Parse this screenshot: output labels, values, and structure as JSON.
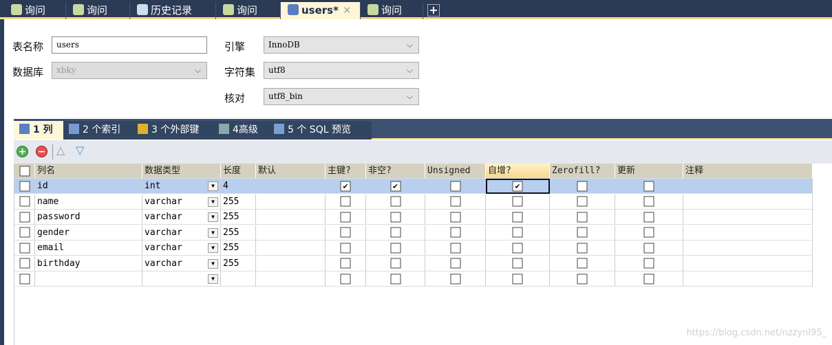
{
  "tabs": [
    {
      "label": "询问",
      "icon": "query-icon"
    },
    {
      "label": "询问",
      "icon": "query-icon"
    },
    {
      "label": "历史记录",
      "icon": "calendar-icon"
    },
    {
      "label": "询问",
      "icon": "query-icon"
    },
    {
      "label": "users*",
      "icon": "table-design-icon",
      "active": true,
      "close": "✕"
    },
    {
      "label": "询问",
      "icon": "query-icon"
    }
  ],
  "new_tab": "+",
  "form": {
    "table_name_label": "表名称",
    "table_name": "users",
    "database_label": "数据库",
    "database": "xbky",
    "engine_label": "引擎",
    "engine": "InnoDB",
    "charset_label": "字符集",
    "charset": "utf8",
    "collation_label": "核对",
    "collation": "utf8_bin"
  },
  "subtabs": [
    {
      "label": "1 列",
      "active": true,
      "icon": "columns-icon"
    },
    {
      "label": "2 个索引",
      "icon": "index-icon"
    },
    {
      "label": "3 个外部键",
      "icon": "foreign-key-icon"
    },
    {
      "label": "4高级",
      "icon": "advanced-icon"
    },
    {
      "label": "5 个 SQL 预览",
      "icon": "sql-preview-icon"
    }
  ],
  "toolbar": {
    "add": "+",
    "remove": "−",
    "up": "△",
    "down": "▽"
  },
  "headers": [
    "列名",
    "数据类型",
    "长度",
    "默认",
    "主键?",
    "非空?",
    "Unsigned",
    "自增?",
    "Zerofill?",
    "更新",
    "注释"
  ],
  "rows": [
    {
      "name": "id",
      "type": "int",
      "length": "4",
      "default": "",
      "pk": true,
      "notnull": true,
      "unsigned": false,
      "ai": true,
      "zerofill": false,
      "update": false,
      "comment": ""
    },
    {
      "name": "name",
      "type": "varchar",
      "length": "255",
      "default": "",
      "pk": false,
      "notnull": false,
      "unsigned": false,
      "ai": false,
      "zerofill": false,
      "update": false,
      "comment": ""
    },
    {
      "name": "password",
      "type": "varchar",
      "length": "255",
      "default": "",
      "pk": false,
      "notnull": false,
      "unsigned": false,
      "ai": false,
      "zerofill": false,
      "update": false,
      "comment": ""
    },
    {
      "name": "gender",
      "type": "varchar",
      "length": "255",
      "default": "",
      "pk": false,
      "notnull": false,
      "unsigned": false,
      "ai": false,
      "zerofill": false,
      "update": false,
      "comment": ""
    },
    {
      "name": "email",
      "type": "varchar",
      "length": "255",
      "default": "",
      "pk": false,
      "notnull": false,
      "unsigned": false,
      "ai": false,
      "zerofill": false,
      "update": false,
      "comment": ""
    },
    {
      "name": "birthday",
      "type": "varchar",
      "length": "255",
      "default": "",
      "pk": false,
      "notnull": false,
      "unsigned": false,
      "ai": false,
      "zerofill": false,
      "update": false,
      "comment": ""
    },
    {
      "name": "",
      "type": "",
      "length": "",
      "default": "",
      "pk": false,
      "notnull": false,
      "unsigned": false,
      "ai": false,
      "zerofill": false,
      "update": false,
      "comment": ""
    }
  ],
  "watermark": "https://blog.csdn.net/nzzynl95_"
}
